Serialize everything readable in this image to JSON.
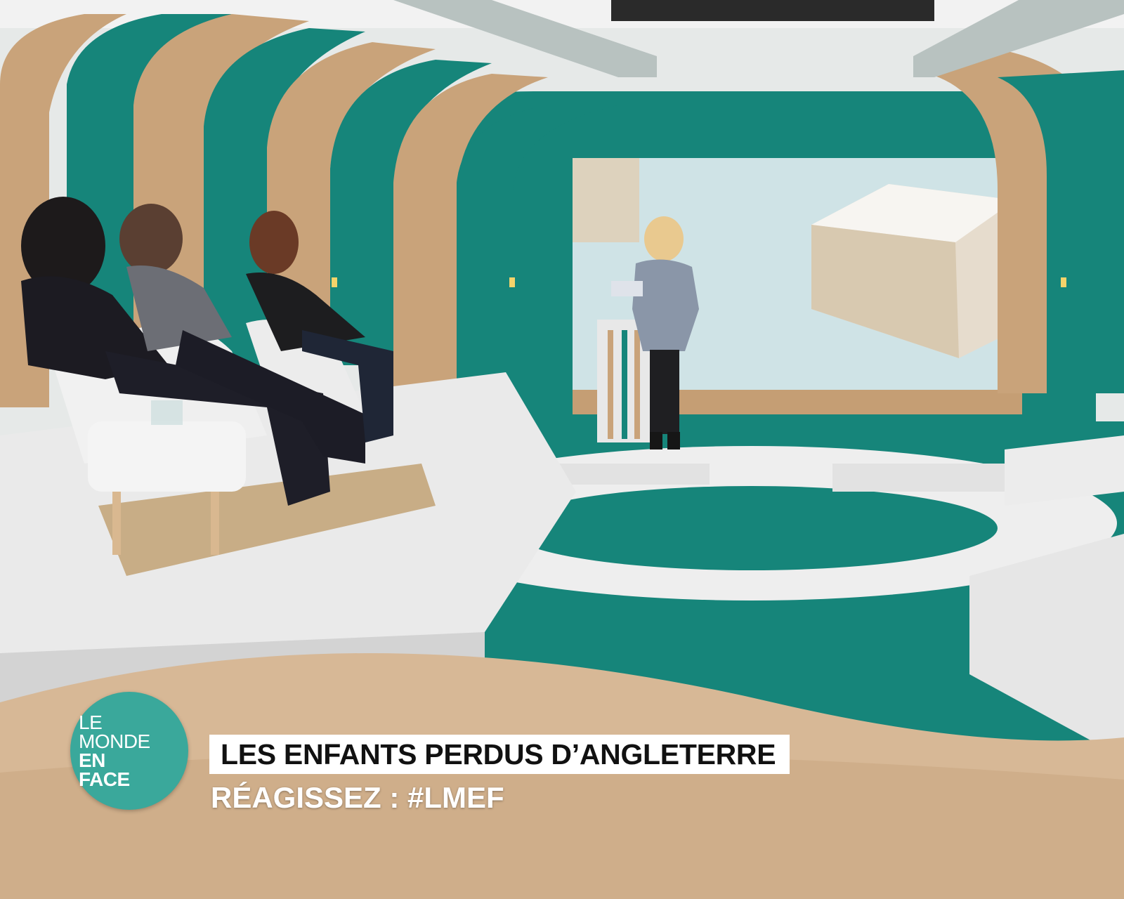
{
  "logo": {
    "lines": [
      "LE",
      "MONDE",
      "EN",
      "FACE"
    ]
  },
  "caption": {
    "title": "LES ENFANTS PERDUS D’ANGLETERRE",
    "react": "RÉAGISSEZ  : #LMEF"
  },
  "colors": {
    "teal": "#16857a",
    "wood": "#c9a37a",
    "white_set": "#eeeeee"
  }
}
